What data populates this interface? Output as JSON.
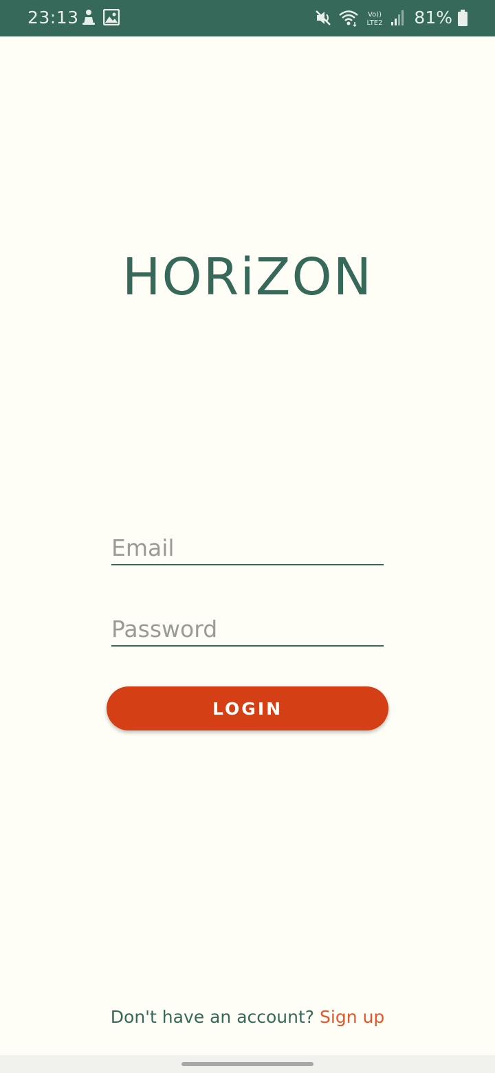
{
  "status_bar": {
    "time": "23:13",
    "battery": "81%",
    "network_label": "Vo))\nLTE2",
    "icons": [
      "person-icon",
      "image-icon",
      "mute-icon",
      "wifi-icon",
      "lte-icon",
      "signal-icon",
      "battery-icon"
    ]
  },
  "app": {
    "logo": "HORiZON"
  },
  "form": {
    "email_placeholder": "Email",
    "email_value": "",
    "password_placeholder": "Password",
    "password_value": "",
    "login_label": "LOGIN"
  },
  "footer": {
    "signup_prompt": "Don't have an account?",
    "signup_link": "Sign up"
  },
  "colors": {
    "primary": "#36695a",
    "accent": "#d43f15",
    "link": "#e9552a",
    "background": "#fefef6"
  }
}
